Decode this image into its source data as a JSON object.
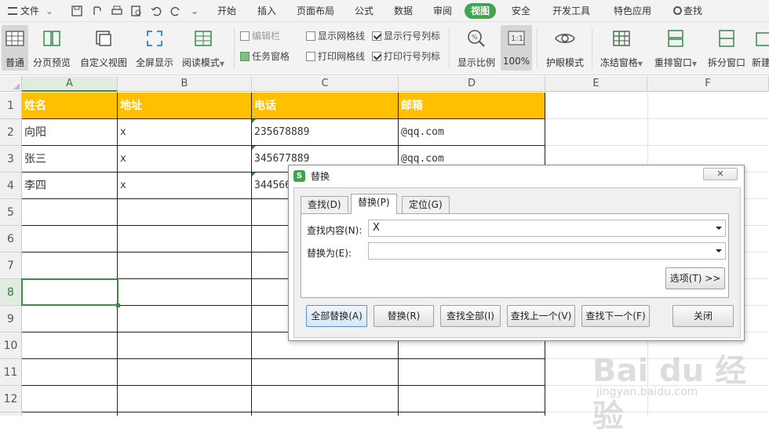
{
  "menu": {
    "file": "文件",
    "tabs": [
      "开始",
      "插入",
      "页面布局",
      "公式",
      "数据",
      "审阅",
      "视图",
      "安全",
      "开发工具",
      "特色应用"
    ],
    "active_tab": "视图",
    "search": "查找"
  },
  "ribbon": {
    "normal": "普通",
    "page_break": "分页预览",
    "custom_view": "自定义视图",
    "full_screen": "全屏显示",
    "reading_mode": "阅读模式",
    "edit_bar": "编辑栏",
    "task_pane": "任务窗格",
    "show_gridlines": "显示网格线",
    "print_gridlines": "打印网格线",
    "show_row_col": "显示行号列标",
    "print_row_col": "打印行号列标",
    "zoom": "显示比例",
    "zoom_100": "100%",
    "zoom_100_icon": "1:1",
    "eye_mode": "护眼模式",
    "freeze": "冻结窗格",
    "arrange": "重排窗口",
    "split": "拆分窗口",
    "new_window": "新建"
  },
  "sheet": {
    "columns": [
      "A",
      "B",
      "C",
      "D",
      "E",
      "F"
    ],
    "rows": [
      "1",
      "2",
      "3",
      "4",
      "5",
      "6",
      "7",
      "8",
      "9",
      "10",
      "11",
      "12"
    ],
    "header": [
      "姓名",
      "地址",
      "电话",
      "邮箱"
    ],
    "data": [
      [
        "向阳",
        "x",
        "235678889",
        "@qq.com"
      ],
      [
        "张三",
        "x",
        "345677889",
        "@qq.com"
      ],
      [
        "李四",
        "x",
        "344566",
        ""
      ]
    ]
  },
  "dialog": {
    "title": "替换",
    "logo": "S",
    "close": "✕",
    "tabs": [
      "查找(D)",
      "替换(P)",
      "定位(G)"
    ],
    "find_label": "查找内容(N):",
    "find_value": "X",
    "replace_label": "替换为(E):",
    "replace_value": "",
    "options": "选项(T) >>",
    "buttons": [
      "全部替换(A)",
      "替换(R)",
      "查找全部(I)",
      "查找上一个(V)",
      "查找下一个(F)",
      "关闭"
    ]
  },
  "watermark": {
    "logo": "Bai du 经验",
    "url": "jingyan.baidu.com"
  }
}
